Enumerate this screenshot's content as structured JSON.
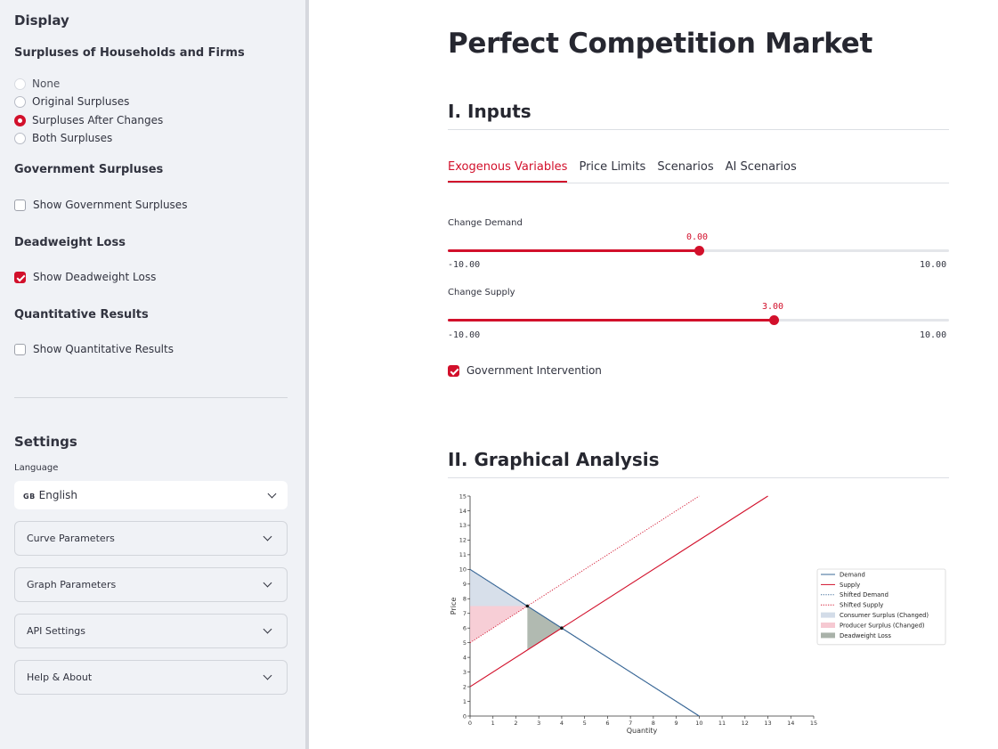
{
  "sidebar": {
    "display_heading": "Display",
    "surpluses_heading": "Surpluses of Households and Firms",
    "surplus_options": [
      {
        "label": "None",
        "selected": false
      },
      {
        "label": "Original Surpluses",
        "selected": false
      },
      {
        "label": "Surpluses After Changes",
        "selected": true
      },
      {
        "label": "Both Surpluses",
        "selected": false
      }
    ],
    "gov_heading": "Government Surpluses",
    "gov_checkbox": {
      "label": "Show Government Surpluses",
      "checked": false
    },
    "dwl_heading": "Deadweight Loss",
    "dwl_checkbox": {
      "label": "Show Deadweight Loss",
      "checked": true
    },
    "quant_heading": "Quantitative Results",
    "quant_checkbox": {
      "label": "Show Quantitative Results",
      "checked": false
    },
    "settings_heading": "Settings",
    "language_label": "Language",
    "language_flag": "GB",
    "language_value": "English",
    "expanders": [
      "Curve Parameters",
      "Graph Parameters",
      "API Settings",
      "Help & About"
    ]
  },
  "main": {
    "title": "Perfect Competition Market",
    "inputs_heading": "I. Inputs",
    "tabs": [
      {
        "label": "Exogenous Variables",
        "active": true
      },
      {
        "label": "Price Limits",
        "active": false
      },
      {
        "label": "Scenarios",
        "active": false
      },
      {
        "label": "AI Scenarios",
        "active": false
      }
    ],
    "sliders": [
      {
        "label": "Change Demand",
        "value": "0.00",
        "min": "-10.00",
        "max": "10.00",
        "fraction": 0.5
      },
      {
        "label": "Change Supply",
        "value": "3.00",
        "min": "-10.00",
        "max": "10.00",
        "fraction": 0.65
      }
    ],
    "gov_intervention": {
      "label": "Government Intervention",
      "checked": true
    },
    "graph_heading": "II. Graphical Analysis"
  },
  "colors": {
    "accent": "#d2102b",
    "demand": "#3a6897",
    "supply": "#d2102b",
    "consumer_surplus": "#d3dce8",
    "producer_surplus": "#f6c9d2",
    "deadweight_loss": "#a9b2a9"
  },
  "chart_data": {
    "type": "line",
    "xlabel": "Quantity",
    "ylabel": "Price",
    "xlim": [
      0,
      15
    ],
    "ylim": [
      0,
      15
    ],
    "x_ticks": [
      "0",
      "1",
      "2",
      "3",
      "4",
      "5",
      "6",
      "7",
      "8",
      "9",
      "10",
      "11",
      "12",
      "13",
      "14",
      "15"
    ],
    "y_ticks": [
      "0",
      "1",
      "2",
      "3",
      "4",
      "5",
      "6",
      "7",
      "8",
      "9",
      "10",
      "11",
      "12",
      "13",
      "14",
      "15"
    ],
    "grid": false,
    "legend_position": "right",
    "series": [
      {
        "name": "Demand",
        "style": "solid",
        "color": "#3a6897",
        "points": [
          [
            0,
            10
          ],
          [
            10,
            0
          ]
        ]
      },
      {
        "name": "Supply",
        "style": "solid",
        "color": "#d2102b",
        "points": [
          [
            0,
            2
          ],
          [
            13,
            15
          ]
        ]
      },
      {
        "name": "Shifted Demand",
        "style": "dotted",
        "color": "#3a6897",
        "points": [
          [
            0,
            10
          ],
          [
            10,
            0
          ]
        ]
      },
      {
        "name": "Shifted Supply",
        "style": "dotted",
        "color": "#d2102b",
        "points": [
          [
            0,
            5
          ],
          [
            10,
            15
          ]
        ]
      }
    ],
    "areas": [
      {
        "name": "Consumer Surplus (Changed)",
        "color": "#d3dce8",
        "polygon": [
          [
            0,
            10
          ],
          [
            0,
            7.5
          ],
          [
            2.5,
            7.5
          ]
        ]
      },
      {
        "name": "Producer Surplus (Changed)",
        "color": "#f6c9d2",
        "polygon": [
          [
            0,
            7.5
          ],
          [
            0,
            5
          ],
          [
            2.5,
            7.5
          ]
        ]
      },
      {
        "name": "Deadweight Loss",
        "color": "#a9b2a9",
        "polygon": [
          [
            2.5,
            7.5
          ],
          [
            2.5,
            4.5
          ],
          [
            4,
            6
          ]
        ]
      }
    ],
    "points": [
      [
        2.5,
        7.5
      ],
      [
        4,
        6
      ]
    ]
  }
}
